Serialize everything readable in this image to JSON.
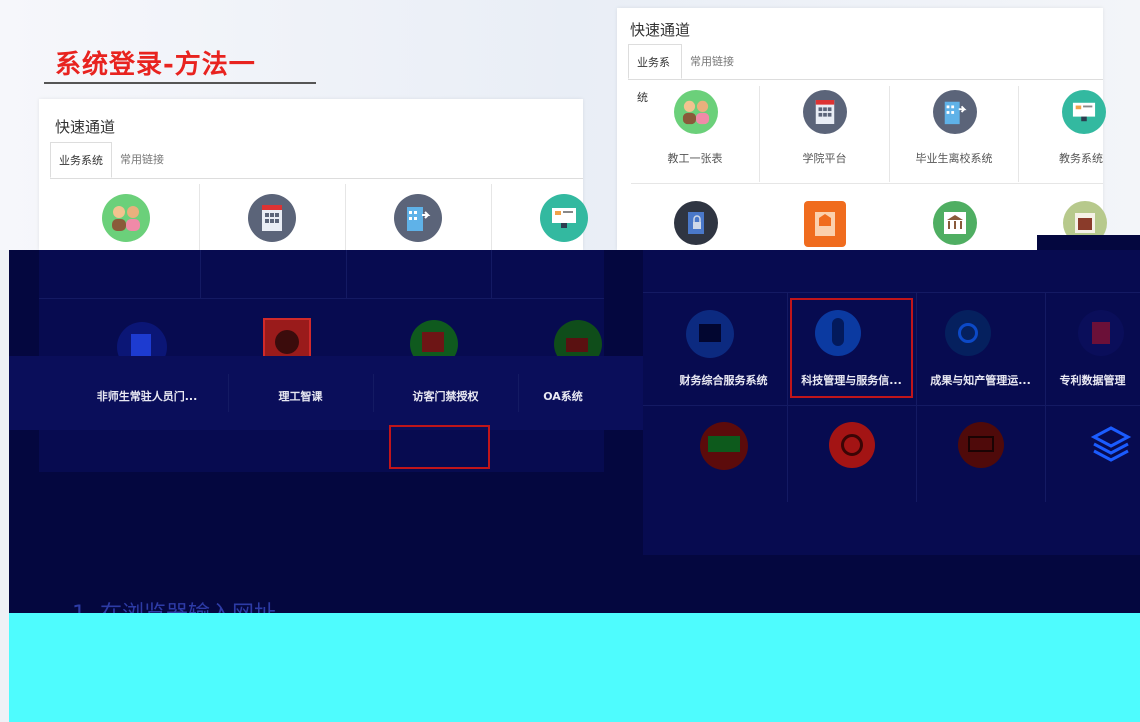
{
  "slide": {
    "title": "系统登录-方法一"
  },
  "left_panel": {
    "heading": "快速通道",
    "tabs": [
      "业务系统",
      "常用链接"
    ],
    "row1_icons": [
      "people-icon",
      "building-icon",
      "building-arrow-icon",
      "classroom-screen-icon"
    ],
    "row2": [
      {
        "label": "非师生常驻人员门...",
        "icon": "id-card-icon"
      },
      {
        "label": "理工智课",
        "icon": "smart-course-icon"
      },
      {
        "label": "访客门禁授权",
        "icon": "gate-auth-icon"
      },
      {
        "label": "OA系统",
        "icon": "oa-icon"
      }
    ]
  },
  "right_panel": {
    "heading": "快速通道",
    "tabs": [
      "业务系统",
      "常用链接"
    ],
    "row1": [
      {
        "label": "教工一张表",
        "icon": "people-icon"
      },
      {
        "label": "学院平台",
        "icon": "building-icon"
      },
      {
        "label": "毕业生离校系统",
        "icon": "building-arrow-icon"
      },
      {
        "label": "教务系统",
        "icon": "classroom-screen-icon"
      }
    ],
    "row2_icons": [
      "lock-door-icon",
      "book-cover-icon",
      "bank-icon",
      "cabinet-icon"
    ],
    "row3": [
      {
        "label": "财务综合服务系统",
        "icon": "finance-icon"
      },
      {
        "label": "科技管理与服务信...",
        "icon": "scientist-icon"
      },
      {
        "label": "成果与知产管理运...",
        "icon": "copyright-icon"
      },
      {
        "label": "专利数据管理",
        "icon": "patent-icon"
      }
    ],
    "row4_icons": [
      "rent-icon",
      "party-emblem-icon",
      "monitor-icon",
      "layers-icon"
    ]
  },
  "instruction": {
    "text": "1. 在浏览器输入网址"
  },
  "colors": {
    "title_red": "#e8231f",
    "dark_band": "#04073f",
    "cyan_band": "#4efcfe",
    "highlight_red": "#c0151a"
  }
}
